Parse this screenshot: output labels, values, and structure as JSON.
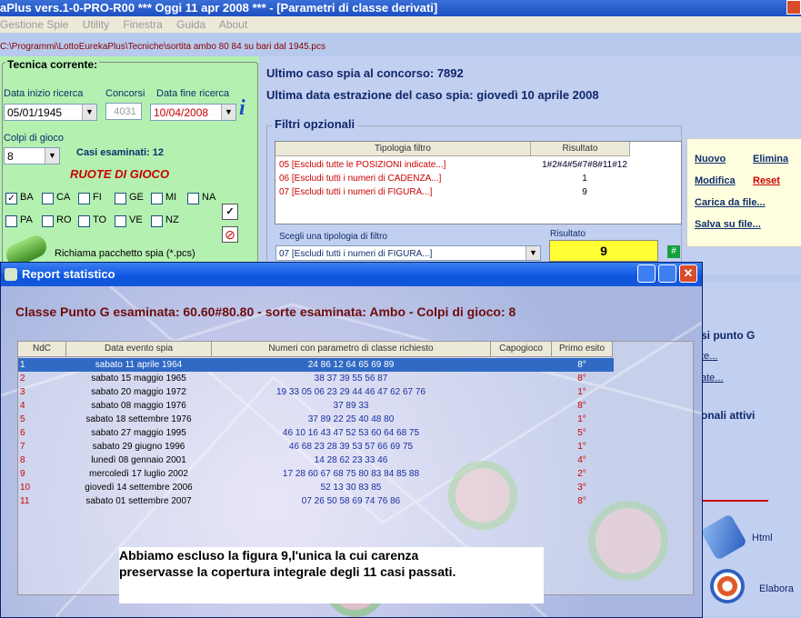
{
  "app": {
    "title": "aPlus vers.1-0-PRO-R00  ***  Oggi 11 apr 2008  ***  - [Parametri di classe derivati]",
    "menu": [
      "Gestione Spie",
      "Utility",
      "Finestra",
      "Guida",
      "About"
    ]
  },
  "path": "C:\\Programmi\\LottoEurekaPlus\\Tecniche\\sortita ambo 80 84 su bari dal 1945.pcs",
  "tecnica": {
    "heading": "Tecnica corrente:",
    "data_inizio_label": "Data inizio ricerca",
    "data_inizio": "05/01/1945",
    "concorsi_label": "Concorsi",
    "concorsi": "4031",
    "data_fine_label": "Data fine ricerca",
    "data_fine": "10/04/2008",
    "colpi_label": "Colpi di gioco",
    "colpi": "8",
    "casi_label": "Casi esaminati: 12",
    "ruote_title": "RUOTE  DI  GIOCO",
    "ruote": [
      {
        "name": "BA",
        "checked": true
      },
      {
        "name": "CA",
        "checked": false
      },
      {
        "name": "FI",
        "checked": false
      },
      {
        "name": "GE",
        "checked": false
      },
      {
        "name": "MI",
        "checked": false
      },
      {
        "name": "NA",
        "checked": false
      },
      {
        "name": "PA",
        "checked": false
      },
      {
        "name": "RO",
        "checked": false
      },
      {
        "name": "TO",
        "checked": false
      },
      {
        "name": "VE",
        "checked": false
      },
      {
        "name": "NZ",
        "checked": false
      }
    ],
    "richiama_label": "Richiama pacchetto spia (*.pcs)"
  },
  "info": {
    "ultimo_caso": "Ultimo caso spia al concorso:  7892",
    "ultima_data": "Ultima data estrazione del caso spia:  giovedì 10 aprile 2008"
  },
  "filtri": {
    "heading": "Filtri opzionali",
    "col_tipologia": "Tipologia filtro",
    "col_risultato": "Risultato",
    "rows": [
      {
        "tipo": "05 [Escludi tutte le POSIZIONI indicate...]",
        "risultato": "1#2#4#5#7#8#11#12"
      },
      {
        "tipo": "06 [Escludi tutti i numeri di CADENZA...]",
        "risultato": "1"
      },
      {
        "tipo": "07 [Escludi tutti i numeri di FIGURA...]",
        "risultato": "9"
      }
    ],
    "scegli_label": "Scegli una tipologia di filtro",
    "scegli_value": "07 [Escludi tutti i numeri di FIGURA...]",
    "risultato_label": "Risultato",
    "risultato_value": "9",
    "hash_label": "#"
  },
  "actions": {
    "nuovo": "Nuovo",
    "elimina": "Elimina",
    "modifica": "Modifica",
    "reset": "Reset",
    "carica": "Carica da file...",
    "salva": "Salva su file..."
  },
  "side": {
    "punto_g": "si punto G",
    "link1": "te...",
    "link2": "ate...",
    "attivi": "onali attivi",
    "html": "Html",
    "elabora": "Elabora"
  },
  "report": {
    "title": "Report statistico",
    "heading": "Classe Punto G esaminata: 60.60#80.80 - sorte esaminata: Ambo - Colpi di gioco: 8",
    "columns": [
      "NdC",
      "Data evento spia",
      "Numeri con parametro di classe richiesto",
      "Capogioco",
      "Primo esito"
    ],
    "rows": [
      {
        "ndc": "1",
        "data": "sabato 11 aprile 1964",
        "numeri": "24 86 12 64 65 69 89",
        "capo": "",
        "esito": "8°"
      },
      {
        "ndc": "2",
        "data": "sabato 15 maggio 1965",
        "numeri": "38 37 39 55 56 87",
        "capo": "",
        "esito": "8°"
      },
      {
        "ndc": "3",
        "data": "sabato 20 maggio 1972",
        "numeri": "19 33 05 06 23 29 44 46 47 62 67 76",
        "capo": "",
        "esito": "1°"
      },
      {
        "ndc": "4",
        "data": "sabato 08 maggio 1976",
        "numeri": "37 89 33",
        "capo": "",
        "esito": "8°"
      },
      {
        "ndc": "5",
        "data": "sabato 18 settembre 1976",
        "numeri": "37 89 22 25 40 48 80",
        "capo": "",
        "esito": "1°"
      },
      {
        "ndc": "6",
        "data": "sabato 27 maggio 1995",
        "numeri": "46 10 16 43 47 52 53 60 64 68 75",
        "capo": "",
        "esito": "5°"
      },
      {
        "ndc": "7",
        "data": "sabato 29 giugno 1996",
        "numeri": "46 68 23 28 39 53 57 66 69 75",
        "capo": "",
        "esito": "1°"
      },
      {
        "ndc": "8",
        "data": "lunedì 08 gennaio 2001",
        "numeri": "14 28 62 23 33 46",
        "capo": "",
        "esito": "4°"
      },
      {
        "ndc": "9",
        "data": "mercoledì 17 luglio 2002",
        "numeri": "17 28 60 67 68 75 80 83 84 85 88",
        "capo": "",
        "esito": "2°"
      },
      {
        "ndc": "10",
        "data": "giovedì 14 settembre 2006",
        "numeri": "52 13 30 83 85",
        "capo": "",
        "esito": "3°"
      },
      {
        "ndc": "11",
        "data": "sabato 01 settembre 2007",
        "numeri": "07 26 50 58 69 74 76 86",
        "capo": "",
        "esito": "8°"
      }
    ],
    "note_line1": "Abbiamo escluso la figura 9,l'unica la cui carenza",
    "note_line2": "preservasse la copertura integrale degli 11 casi passati."
  },
  "colors": {
    "accent": "#0c55e0",
    "row_text_red": "#cc0000",
    "row_text_blue": "#1a2fa0",
    "selected_row": "#316ac5",
    "left_panel": "#b4f0b0",
    "result_box": "#ffff33"
  }
}
